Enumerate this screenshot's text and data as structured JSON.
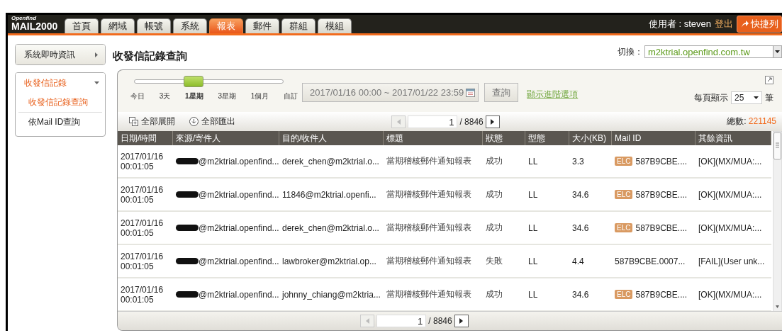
{
  "app": {
    "logo_top": "Openfind",
    "logo_main": "MAIL2000"
  },
  "tabs": [
    {
      "label": "首頁",
      "selected": false
    },
    {
      "label": "網域",
      "selected": false
    },
    {
      "label": "帳號",
      "selected": false
    },
    {
      "label": "系統",
      "selected": false
    },
    {
      "label": "報表",
      "selected": true
    },
    {
      "label": "郵件",
      "selected": false
    },
    {
      "label": "群組",
      "selected": false
    },
    {
      "label": "模組",
      "selected": false
    }
  ],
  "user": {
    "label": "使用者 : steven",
    "logout": "登出",
    "shortcut": "快捷列"
  },
  "sidebar": {
    "items": [
      {
        "label": "系統即時資訊",
        "expanded": false
      },
      {
        "label": "收發信記錄",
        "expanded": true,
        "children": [
          {
            "label": "收發信記錄查詢",
            "selected": true
          },
          {
            "label": "依Mail ID查詢",
            "selected": false
          }
        ]
      }
    ]
  },
  "page_title": "收發信記錄查詢",
  "domain_switch": {
    "label": "切換：",
    "value": "m2ktrial.openfind.com.tw"
  },
  "range_slider": {
    "level": 0.4,
    "stops": [
      {
        "label": "今日",
        "selected": false
      },
      {
        "label": "3天",
        "selected": false
      },
      {
        "label": "1星期",
        "selected": true
      },
      {
        "label": "3星期",
        "selected": false
      },
      {
        "label": "1個月",
        "selected": false
      },
      {
        "label": "自訂",
        "selected": false
      }
    ]
  },
  "date_range": "2017/01/16 00:00 ~ 2017/01/22 23:59",
  "query_button": "查詢",
  "advanced_link": "顯示進階選項",
  "page_size": {
    "label": "每頁顯示",
    "value": "25",
    "unit": "筆"
  },
  "toolbar": {
    "expand_all": "全部展開",
    "export_all": "全部匯出"
  },
  "pager_top": {
    "page": "1",
    "total": "/ 8846"
  },
  "total": {
    "label": "總數:",
    "value": "221145"
  },
  "table": {
    "columns": [
      "日期/時間",
      "來源/寄件人",
      "目的/收件人",
      "標題",
      "狀態",
      "型態",
      "大小(KB)",
      "Mail ID",
      "其餘資訊"
    ],
    "rows": [
      {
        "date": "2017/01/16",
        "time": "00:01:05",
        "sender": "@m2ktrial.openfind...",
        "sender_redacted": true,
        "recipient": "derek_chen@m2ktrial.o...",
        "subject": "當期稽核郵件通知報表",
        "status": "成功",
        "type": "LL",
        "size": "3.3",
        "tag": "ELC",
        "mail_id": "587B9CBE....",
        "info": "[OK](MX/MUA:..."
      },
      {
        "date": "2017/01/16",
        "time": "00:01:05",
        "sender": "@m2ktrial.openfind...",
        "sender_redacted": true,
        "recipient": "11846@m2ktrial.openfi...",
        "subject": "當期稽核郵件通知報表",
        "status": "成功",
        "type": "LL",
        "size": "34.6",
        "tag": "ELC",
        "mail_id": "587B9CBE....",
        "info": "[OK](MX/MUA:..."
      },
      {
        "date": "2017/01/16",
        "time": "00:01:05",
        "sender": "@m2ktrial.openfind...",
        "sender_redacted": true,
        "recipient": "derek_chen@m2ktrial.o...",
        "subject": "當期稽核郵件通知報表",
        "status": "成功",
        "type": "LL",
        "size": "34.6",
        "tag": "ELC",
        "mail_id": "587B9CBE....",
        "info": "[OK](MX/MUA:..."
      },
      {
        "date": "2017/01/16",
        "time": "00:01:05",
        "sender": "@m2ktrial.openfind...",
        "sender_redacted": true,
        "recipient": "lawbroker@m2ktrial.op...",
        "subject": "當期稽核郵件通知報表",
        "status": "失敗",
        "type": "LL",
        "size": "4.4",
        "mail_id": "587B9CBE.0007...",
        "info": "[FAIL](User unk..."
      },
      {
        "date": "2017/01/16",
        "time": "00:01:05",
        "sender": "@m2ktrial.openfind...",
        "sender_redacted": true,
        "recipient": "johnny_chiang@m2ktria...",
        "subject": "當期稽核郵件通知報表",
        "status": "成功",
        "type": "LL",
        "size": "34.6",
        "tag": "ELC",
        "mail_id": "587B9CBE....",
        "info": "[OK](MX/MUA:..."
      }
    ]
  },
  "pager_bottom": {
    "page": "1",
    "total": "/ 8846"
  }
}
